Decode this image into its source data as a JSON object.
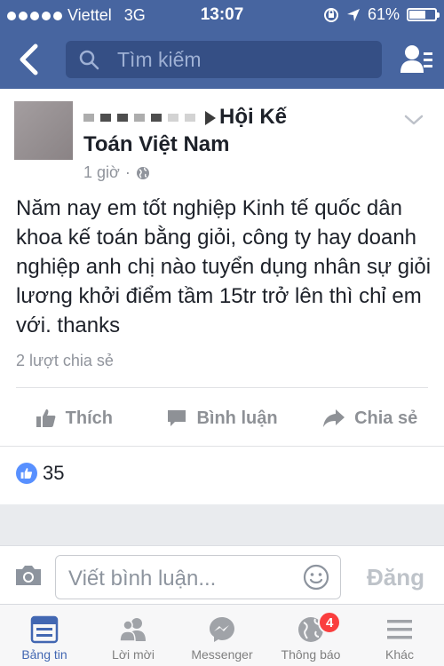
{
  "status_bar": {
    "carrier": "Viettel",
    "network": "3G",
    "time": "13:07",
    "battery_percent": "61%",
    "battery_level": 0.61
  },
  "nav": {
    "search_placeholder": "Tìm kiếm",
    "icons": [
      "back-chevron-icon",
      "search-icon",
      "friend-requests-icon"
    ]
  },
  "post": {
    "group_name_line1": "Hội Kế",
    "group_name_line2": "Toán Việt Nam",
    "time_ago": "1 giờ",
    "separator": "·",
    "content": "Năm nay em tốt nghiệp Kinh tế quốc dân khoa kế toán bằng giỏi, công ty hay doanh nghiệp anh chị nào tuyển dụng nhân sự giỏi lương khởi điểm tầm 15tr trở lên thì chỉ em với. thanks",
    "shares": "2 lượt chia sẻ",
    "actions": {
      "like": "Thích",
      "comment": "Bình luận",
      "share": "Chia sẻ"
    },
    "like_count": "35"
  },
  "comment_bar": {
    "placeholder": "Viết bình luận...",
    "post_label": "Đăng"
  },
  "tabs": [
    {
      "label": "Bảng tin",
      "icon": "news-feed-icon",
      "active": true
    },
    {
      "label": "Lời mời",
      "icon": "friend-requests-icon",
      "active": false
    },
    {
      "label": "Messenger",
      "icon": "messenger-icon",
      "active": false
    },
    {
      "label": "Thông báo",
      "icon": "notifications-globe-icon",
      "active": false,
      "badge": "4"
    },
    {
      "label": "Khác",
      "icon": "more-menu-icon",
      "active": false
    }
  ],
  "colors": {
    "brand_blue": "#4765a0",
    "active_tab": "#4267b2",
    "like_blue": "#5890ff",
    "badge_red": "#fa3e3e"
  }
}
